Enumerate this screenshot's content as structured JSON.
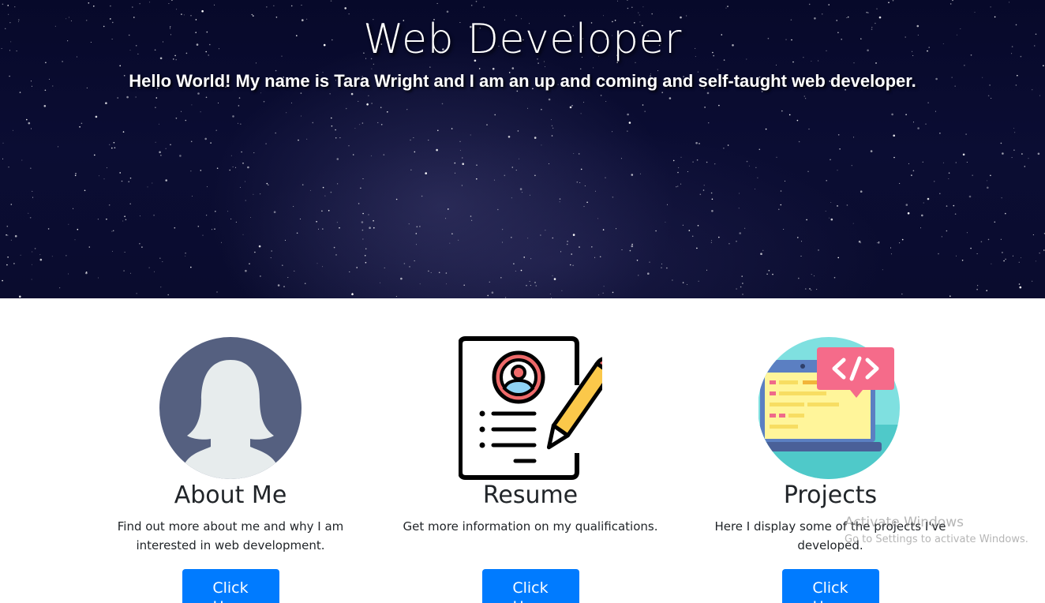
{
  "hero": {
    "title": "Web Developer",
    "subtitle_prefix": "Hello World! My name is ",
    "subtitle_name": "Tara Wright",
    "subtitle_suffix": " and I am an up and coming and self-taught web developer."
  },
  "cards": [
    {
      "title": "About Me",
      "description": "Find out more about me and why I am interested in web development.",
      "button": "Click Here",
      "icon": "female-avatar-icon"
    },
    {
      "title": "Resume",
      "description": "Get more information on my qualifications.",
      "button": "Click Here",
      "icon": "resume-document-icon"
    },
    {
      "title": "Projects",
      "description": "Here I display some of the projects I've developed.",
      "button": "Click Here",
      "icon": "laptop-code-icon"
    }
  ],
  "watermark": {
    "line1": "Activate Windows",
    "line2": "Go to Settings to activate Windows."
  },
  "colors": {
    "primary_button": "#007bff",
    "hero_background": "#0a0c2e",
    "avatar_circle": "#556080",
    "projects_circle": "#4fc9c9"
  }
}
